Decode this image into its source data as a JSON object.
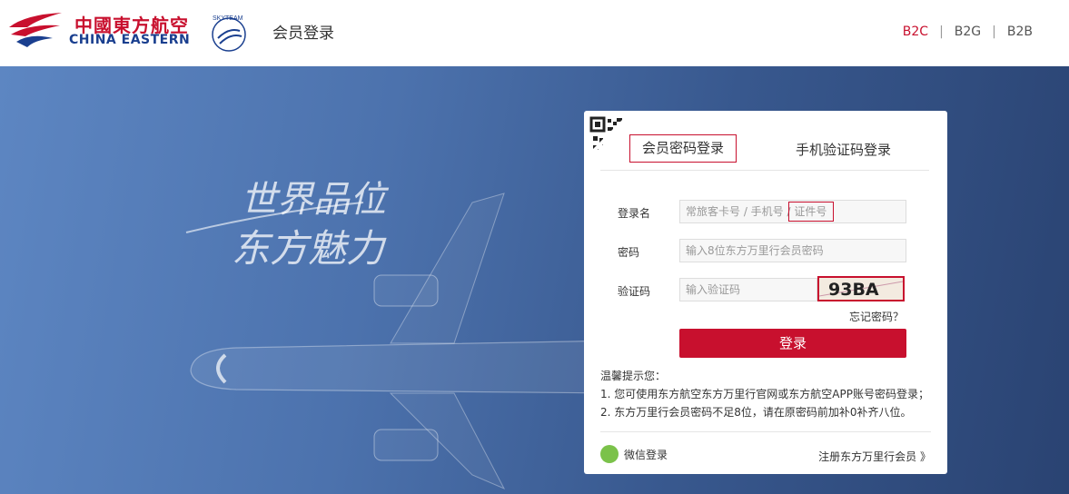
{
  "header": {
    "logo_cn": "中國東方航空",
    "logo_en": "CHINA EASTERN",
    "skyteam_label": "SKYTEAM",
    "page_title": "会员登录",
    "nav": [
      {
        "label": "B2C",
        "active": true
      },
      {
        "label": "B2G",
        "active": false
      },
      {
        "label": "B2B",
        "active": false
      }
    ],
    "nav_separator": "|"
  },
  "hero": {
    "slogan_line1": "世界品位",
    "slogan_line2": "东方魅力"
  },
  "login": {
    "tabs": [
      {
        "label": "会员密码登录",
        "active": true
      },
      {
        "label": "手机验证码登录",
        "active": false
      }
    ],
    "username_label": "登录名",
    "username_placeholder": "常旅客卡号 / 手机号 / 证件号",
    "password_label": "密码",
    "password_placeholder": "输入8位东方万里行会员密码",
    "captcha_label": "验证码",
    "captcha_placeholder": "输入验证码",
    "captcha_text": "93BA",
    "forgot_label": "忘记密码？",
    "submit_label": "登录",
    "tips_title": "温馨提示您：",
    "tips": [
      "1. 您可使用东方航空东方万里行官网或东方航空APP账号密码登录；",
      "2. 东方万里行会员密码不足8位，请在原密码前加补0补齐八位。"
    ],
    "wechat_label": "微信登录",
    "register_label": "注册东方万里行会员 》"
  },
  "colors": {
    "brand_red": "#c8102e",
    "brand_blue": "#1a3f8f"
  }
}
